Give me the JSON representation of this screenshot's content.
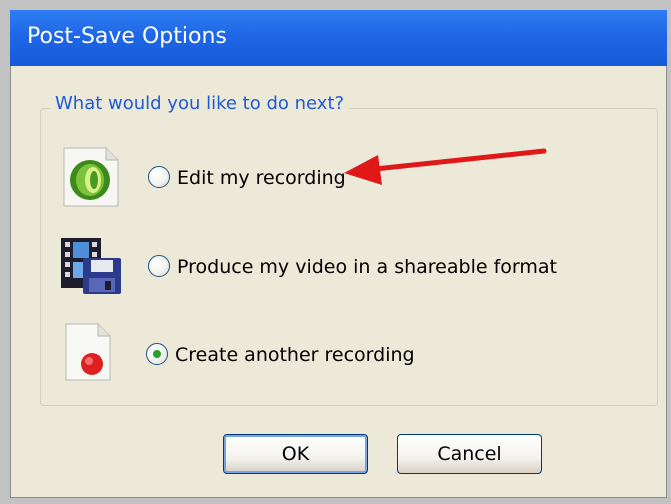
{
  "dialog": {
    "title": "Post-Save Options",
    "question": "What would you like to do next?",
    "options": [
      {
        "label": "Edit my recording",
        "selected": false,
        "icon": "camtasia-studio-icon"
      },
      {
        "label": "Produce my video in a shareable format",
        "selected": false,
        "icon": "film-floppy-icon"
      },
      {
        "label": "Create another recording",
        "selected": true,
        "icon": "record-document-icon"
      }
    ],
    "ok_label": "OK",
    "cancel_label": "Cancel"
  },
  "annotation": {
    "type": "red-arrow",
    "points_to": "Edit my recording",
    "color": "#e01818"
  },
  "colors": {
    "titlebar": "#1f67e6",
    "dialog_bg": "#ece9d8",
    "question_text": "#1f5ad6",
    "radio_dot": "#2a9e2a"
  }
}
